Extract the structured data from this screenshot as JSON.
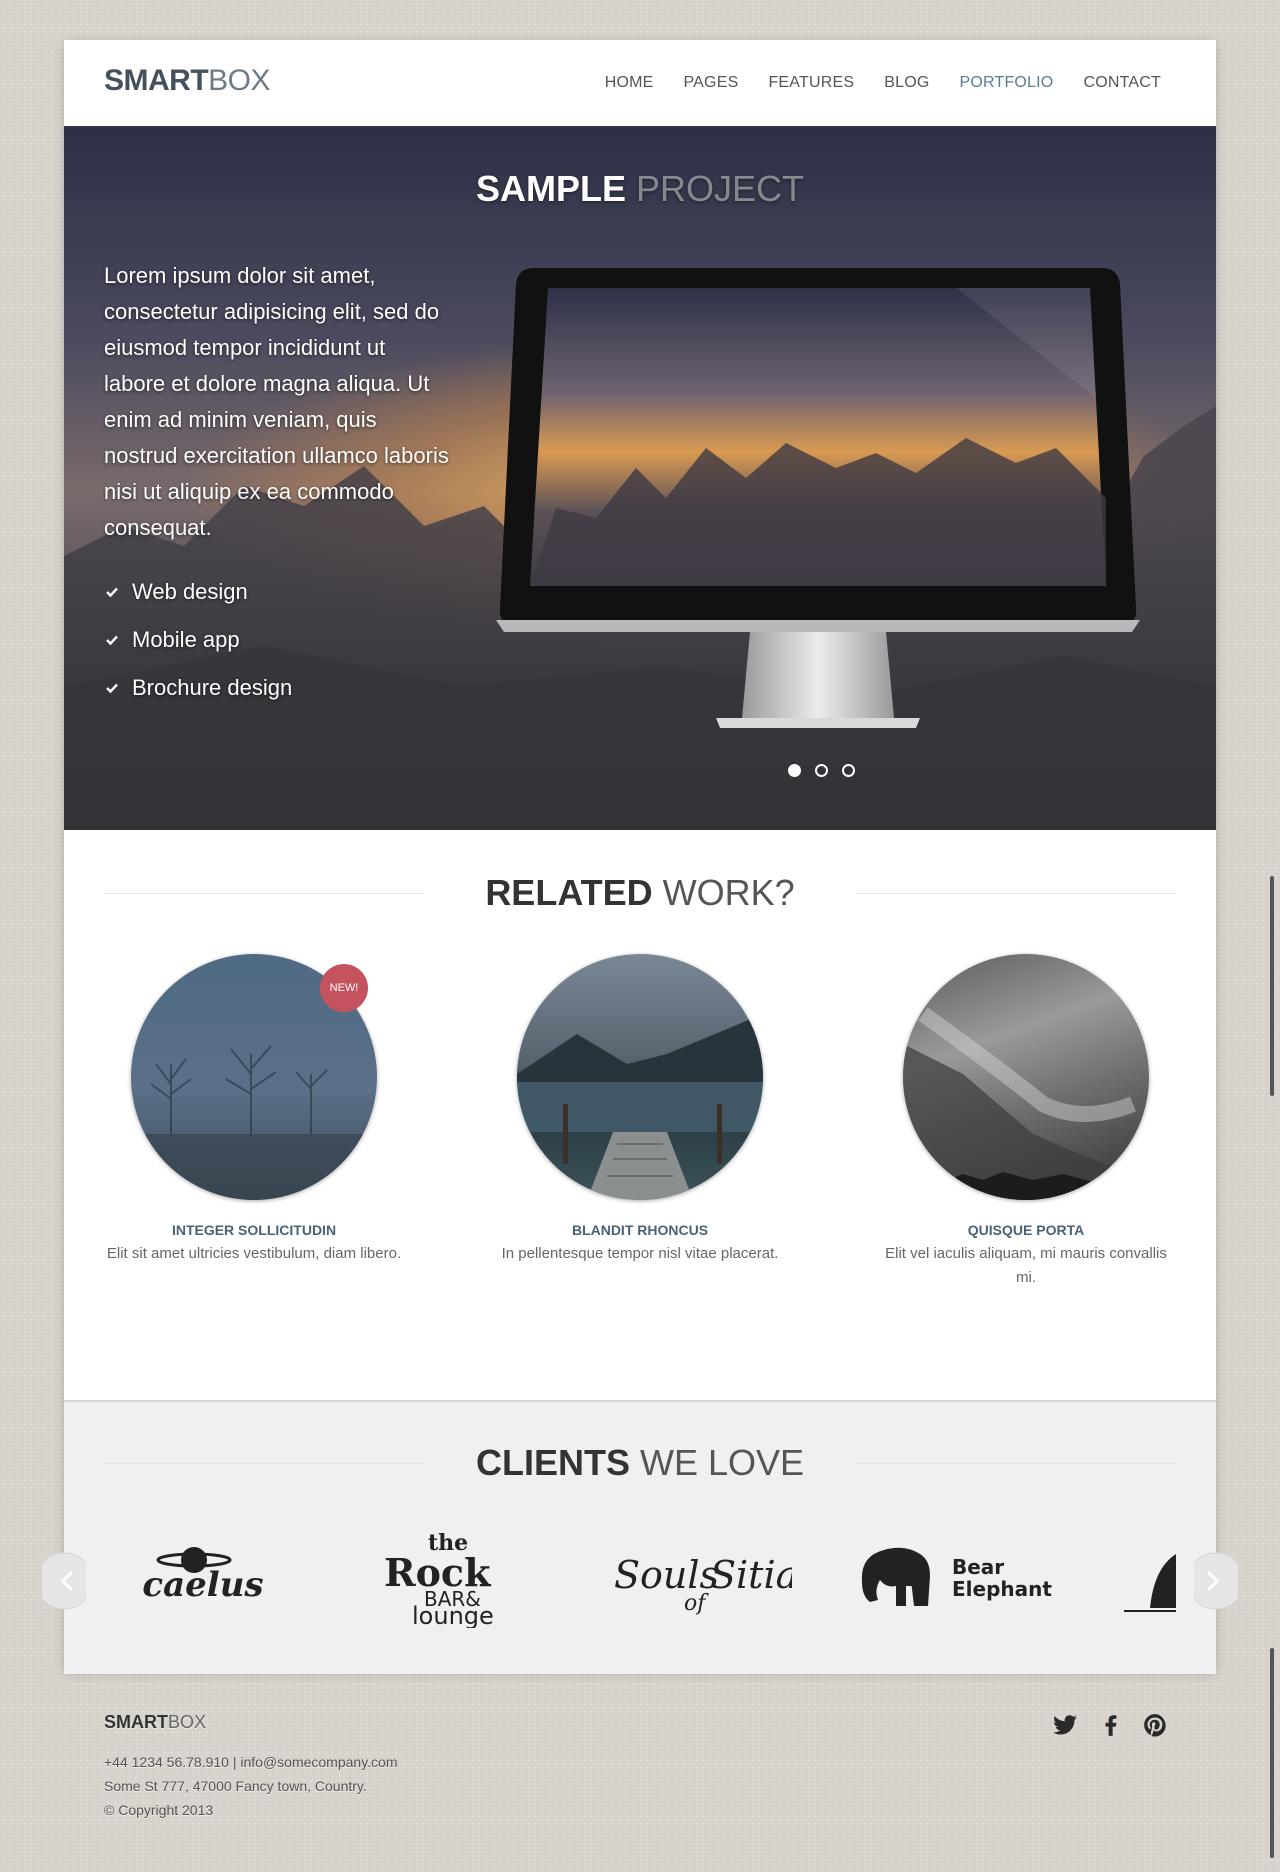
{
  "header": {
    "logo_bold": "SMART",
    "logo_light": "BOX",
    "nav": [
      {
        "label": "HOME",
        "active": false
      },
      {
        "label": "PAGES",
        "active": false
      },
      {
        "label": "FEATURES",
        "active": false
      },
      {
        "label": "BLOG",
        "active": false
      },
      {
        "label": "PORTFOLIO",
        "active": true
      },
      {
        "label": "CONTACT",
        "active": false
      }
    ],
    "accent_color": "#5b7a92"
  },
  "hero": {
    "title_bold": "SAMPLE",
    "title_light": "PROJECT",
    "text": "Lorem ipsum dolor sit amet, consectetur adipisicing elit, sed do eiusmod tempor incididunt ut labore et dolore magna aliqua. Ut enim ad minim veniam, quis nostrud exercitation ullamco laboris nisi ut aliquip ex ea commodo consequat.",
    "features": [
      "Web design",
      "Mobile app",
      "Brochure design"
    ],
    "slides": {
      "count": 3,
      "active": 1
    }
  },
  "related": {
    "heading_bold": "RELATED",
    "heading_light": "WORK?",
    "items": [
      {
        "title": "INTEGER SOLLICITUDIN",
        "desc": "Elit sit amet ultricies vestibulum, diam libero.",
        "badge": "NEW!"
      },
      {
        "title": "BLANDIT RHONCUS",
        "desc": "In pellentesque tempor nisl vitae placerat.",
        "badge": ""
      },
      {
        "title": "QUISQUE PORTA",
        "desc": "Elit vel iaculis aliquam, mi mauris convallis mi.",
        "badge": ""
      }
    ],
    "badge_color": "#c5535e"
  },
  "clients": {
    "heading_bold": "CLIENTS",
    "heading_light": "WE LOVE",
    "logos": [
      {
        "text": "caelus"
      },
      {
        "text_1": "the",
        "text_2": "Rock",
        "text_3": "BAR&",
        "text_4": "lounge"
      },
      {
        "text_1": "Souls",
        "text_2": "of",
        "text_3": "Sitia"
      },
      {
        "text_1": "Bear",
        "text_2": "Elephant"
      }
    ]
  },
  "footer": {
    "logo_bold": "SMART",
    "logo_light": "BOX",
    "contact": "+44 1234 56.78.910 | info@somecompany.com",
    "address": "Some St 777, 47000 Fancy town, Country.",
    "copyright": "© Copyright 2013",
    "social": [
      "twitter-icon",
      "facebook-icon",
      "pinterest-icon"
    ]
  }
}
